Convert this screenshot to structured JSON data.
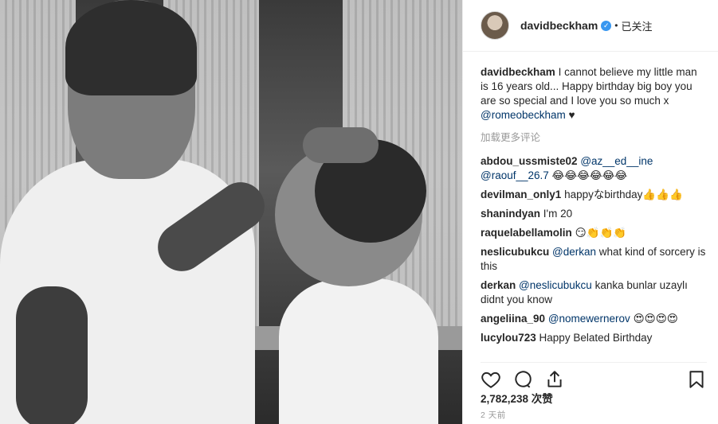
{
  "header": {
    "username": "davidbeckham",
    "separator": "•",
    "follow_status": "已关注"
  },
  "caption": {
    "username": "davidbeckham",
    "text": "I cannot believe my little man is 16 years old... Happy birthday big boy you are so special and I love you so much x ",
    "mention": "@romeobeckham",
    "suffix": "♥"
  },
  "load_more": "加载更多评论",
  "comments": [
    {
      "user": "abdou_ussmiste02",
      "mention": "@az__ed__ine @raouf__26.7",
      "text": "",
      "emoji": "😂😂😂😂😂😂"
    },
    {
      "user": "devilman_only1",
      "mention": "",
      "text": "happyなbirthday",
      "emoji": "👍👍👍"
    },
    {
      "user": "shanindyan",
      "mention": "",
      "text": "I'm 20",
      "emoji": ""
    },
    {
      "user": "raquelabellamolin",
      "mention": "",
      "text": "",
      "emoji": "😏👏👏👏"
    },
    {
      "user": "neslicubukcu",
      "mention": "@derkan",
      "text": "what kind of sorcery is this",
      "emoji": ""
    },
    {
      "user": "derkan",
      "mention": "@neslicubukcu",
      "text": "kanka bunlar uzaylı didnt you know",
      "emoji": ""
    },
    {
      "user": "angeliina_90",
      "mention": "@nomewernerov",
      "text": "",
      "emoji": "😍😍😍😍"
    },
    {
      "user": "lucylou723",
      "mention": "",
      "text": "Happy Belated Birthday",
      "emoji": ""
    }
  ],
  "icons": [
    "heart-icon",
    "comment-icon",
    "share-icon",
    "bookmark-icon"
  ],
  "likes": "2,782,238 次赞",
  "timestamp": "2 天前",
  "colors": {
    "verified": "#3897f0",
    "mention": "#003569",
    "muted": "#999999"
  }
}
